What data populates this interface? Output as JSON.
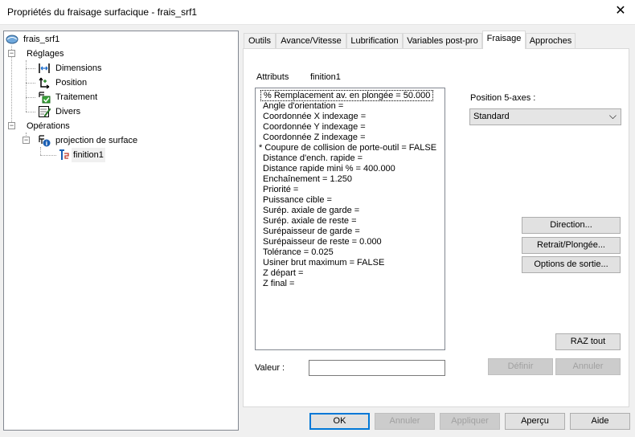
{
  "window": {
    "title": "Propriétés du fraisage surfacique - frais_srf1",
    "close_glyph": "✕"
  },
  "tree": {
    "root": "frais_srf1",
    "reglages": "Réglages",
    "dimensions": "Dimensions",
    "position": "Position",
    "traitement": "Traitement",
    "divers": "Divers",
    "operations": "Opérations",
    "projection": "projection de surface",
    "finition": "finition1"
  },
  "tabs": [
    "Outils",
    "Avance/Vitesse",
    "Lubrification",
    "Variables post-pro",
    "Fraisage",
    "Approches"
  ],
  "active_tab": "Fraisage",
  "attributes": {
    "header_label": "Attributs",
    "header_value": "finition1",
    "items": [
      "% Remplacement av. en plongée = 50.000",
      "Angle d'orientation =",
      "Coordonnée X indexage =",
      "Coordonnée Y indexage =",
      "Coordonnée Z indexage =",
      "* Coupure de collision de porte-outil = FALSE",
      "Distance d'ench. rapide =",
      "Distance rapide mini % = 400.000",
      "Enchaînement = 1.250",
      "Priorité =",
      "Puissance cible =",
      "Surép. axiale de garde =",
      "Surép. axiale de reste =",
      "Surépaisseur de garde =",
      "Surépaisseur de reste = 0.000",
      "Tolérance = 0.025",
      "Usiner brut maximum = FALSE",
      "Z départ =",
      "Z final ="
    ]
  },
  "position5": {
    "label": "Position 5-axes :",
    "selected": "Standard",
    "chevron": "⌵"
  },
  "buttons": {
    "direction": "Direction...",
    "retrait": "Retrait/Plongée...",
    "options": "Options de sortie...",
    "raz": "RAZ tout",
    "definir": "Définir",
    "annuler_inner": "Annuler"
  },
  "valeur": {
    "label": "Valeur :",
    "value": ""
  },
  "footer": {
    "ok": "OK",
    "annuler": "Annuler",
    "appliquer": "Appliquer",
    "apercu": "Aperçu",
    "aide": "Aide"
  }
}
